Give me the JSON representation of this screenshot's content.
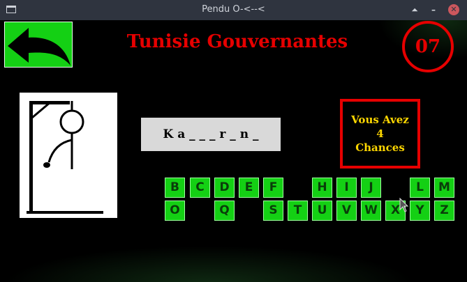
{
  "window": {
    "title": "Pendu O-<--<"
  },
  "header": {
    "title": "Tunisie Gouvernantes",
    "counter": "07"
  },
  "word": {
    "display": "K a _ _ _ r _ n _"
  },
  "chances": {
    "line1": "Vous Avez",
    "count": "4",
    "line2": "Chances"
  },
  "colors": {
    "accent_red": "#e60000",
    "key_green": "#14d014",
    "chances_text": "#ffd700"
  },
  "keyboard": {
    "row1": [
      "B",
      "C",
      "D",
      "E",
      "F",
      "H",
      "I",
      "J",
      "L",
      "M"
    ],
    "row2": [
      "O",
      "Q",
      "S",
      "T",
      "U",
      "V",
      "W",
      "X",
      "Y",
      "Z"
    ]
  }
}
